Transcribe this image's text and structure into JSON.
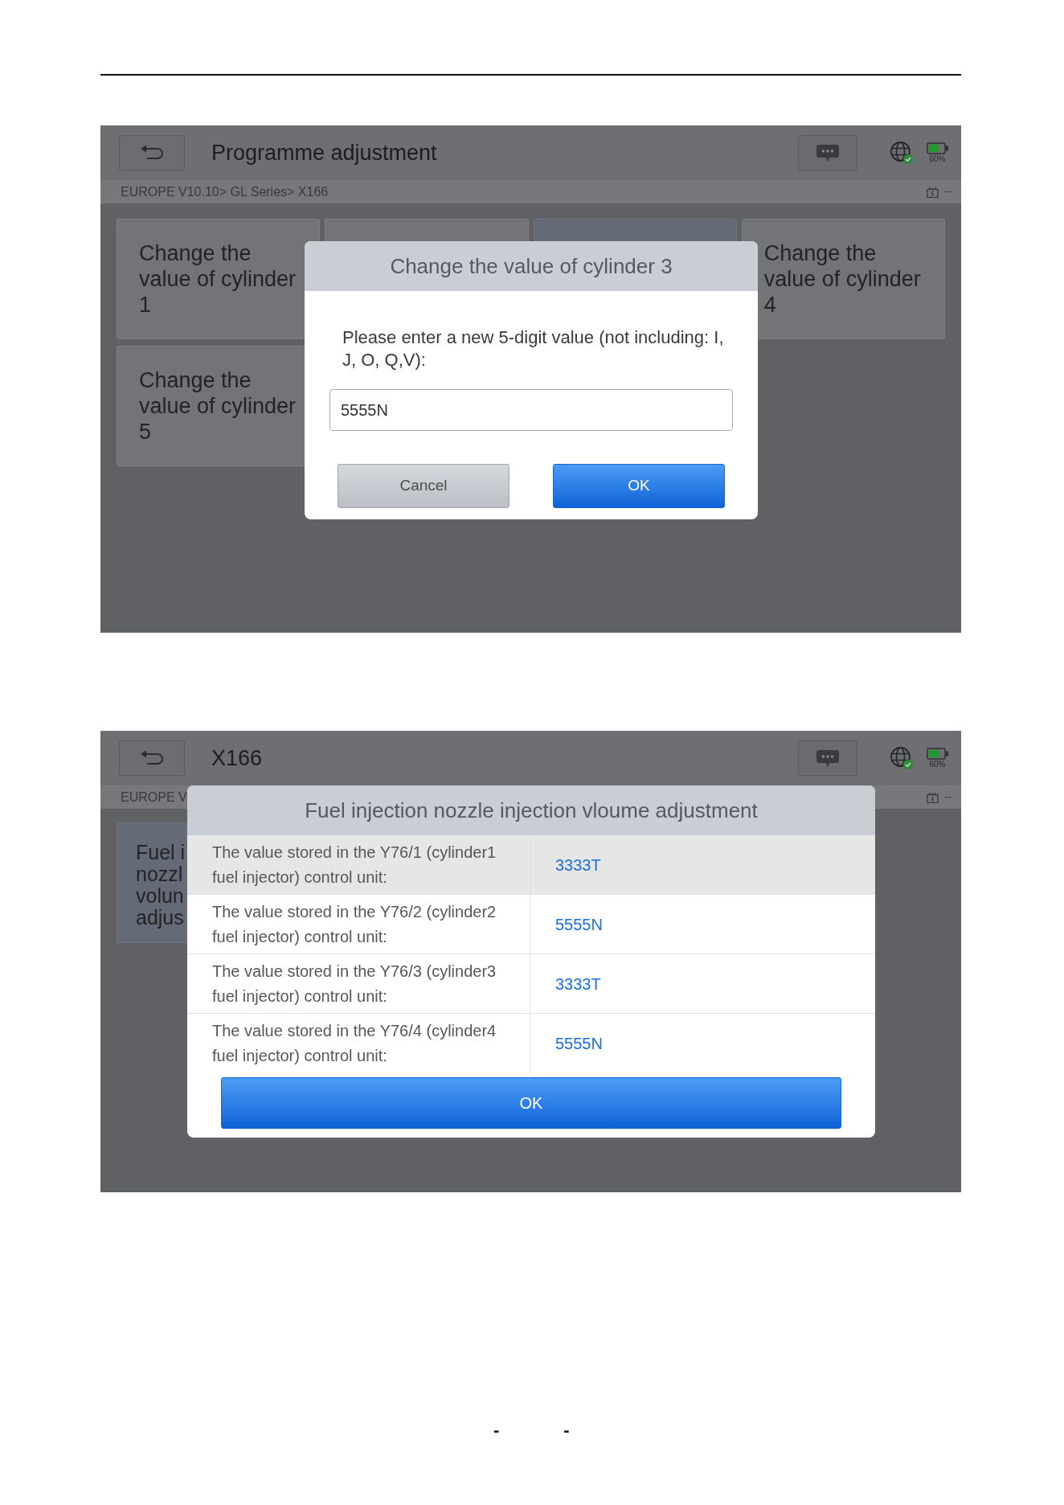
{
  "screens": [
    {
      "header": {
        "title": "Programme adjustment",
        "battery_text": "60%"
      },
      "breadcrumb": {
        "path": "EUROPE V10.10> GL Series> X166",
        "voltage": "--"
      },
      "tiles": [
        {
          "label": "Change the value of cylinder 1",
          "selected": false
        },
        {
          "selected": false
        },
        {
          "selected": true
        },
        {
          "label": "Change the value of cylinder 4",
          "selected": false
        },
        {
          "label": "Change the value of cylinder 5",
          "selected": false
        }
      ],
      "dialog": {
        "kind": "input",
        "title": "Change the value of cylinder 3",
        "prompt": "Please enter a new 5-digit value (not including: I, J, O, Q,V):",
        "input_value": "5555N",
        "buttons": [
          {
            "label": "Cancel",
            "kind": "secondary"
          },
          {
            "label": "OK",
            "kind": "primary"
          }
        ]
      }
    },
    {
      "header": {
        "title": "X166",
        "battery_text": "60%"
      },
      "breadcrumb": {
        "path": "EUROPE V",
        "voltage": "--"
      },
      "tiles": [
        {
          "label": "Fuel i nozzl volun adjus",
          "selected": true
        }
      ],
      "dialog": {
        "kind": "table",
        "title": "Fuel injection nozzle injection vloume adjustment",
        "rows": [
          {
            "label": "The value stored in the Y76/1 (cylinder1 fuel injector) control unit:",
            "value": "3333T",
            "selected": true
          },
          {
            "label": "The value stored in the Y76/2 (cylinder2 fuel injector) control unit:",
            "value": "5555N",
            "selected": false
          },
          {
            "label": "The value stored in the Y76/3 (cylinder3 fuel injector) control unit:",
            "value": "3333T",
            "selected": false
          },
          {
            "label": "The value stored in the Y76/4 (cylinder4 fuel injector) control unit:",
            "value": "5555N",
            "selected": false
          }
        ],
        "buttons": [
          {
            "label": "OK",
            "kind": "primary"
          }
        ]
      }
    }
  ],
  "page_footer": {
    "marks": [
      "-",
      "-"
    ]
  }
}
